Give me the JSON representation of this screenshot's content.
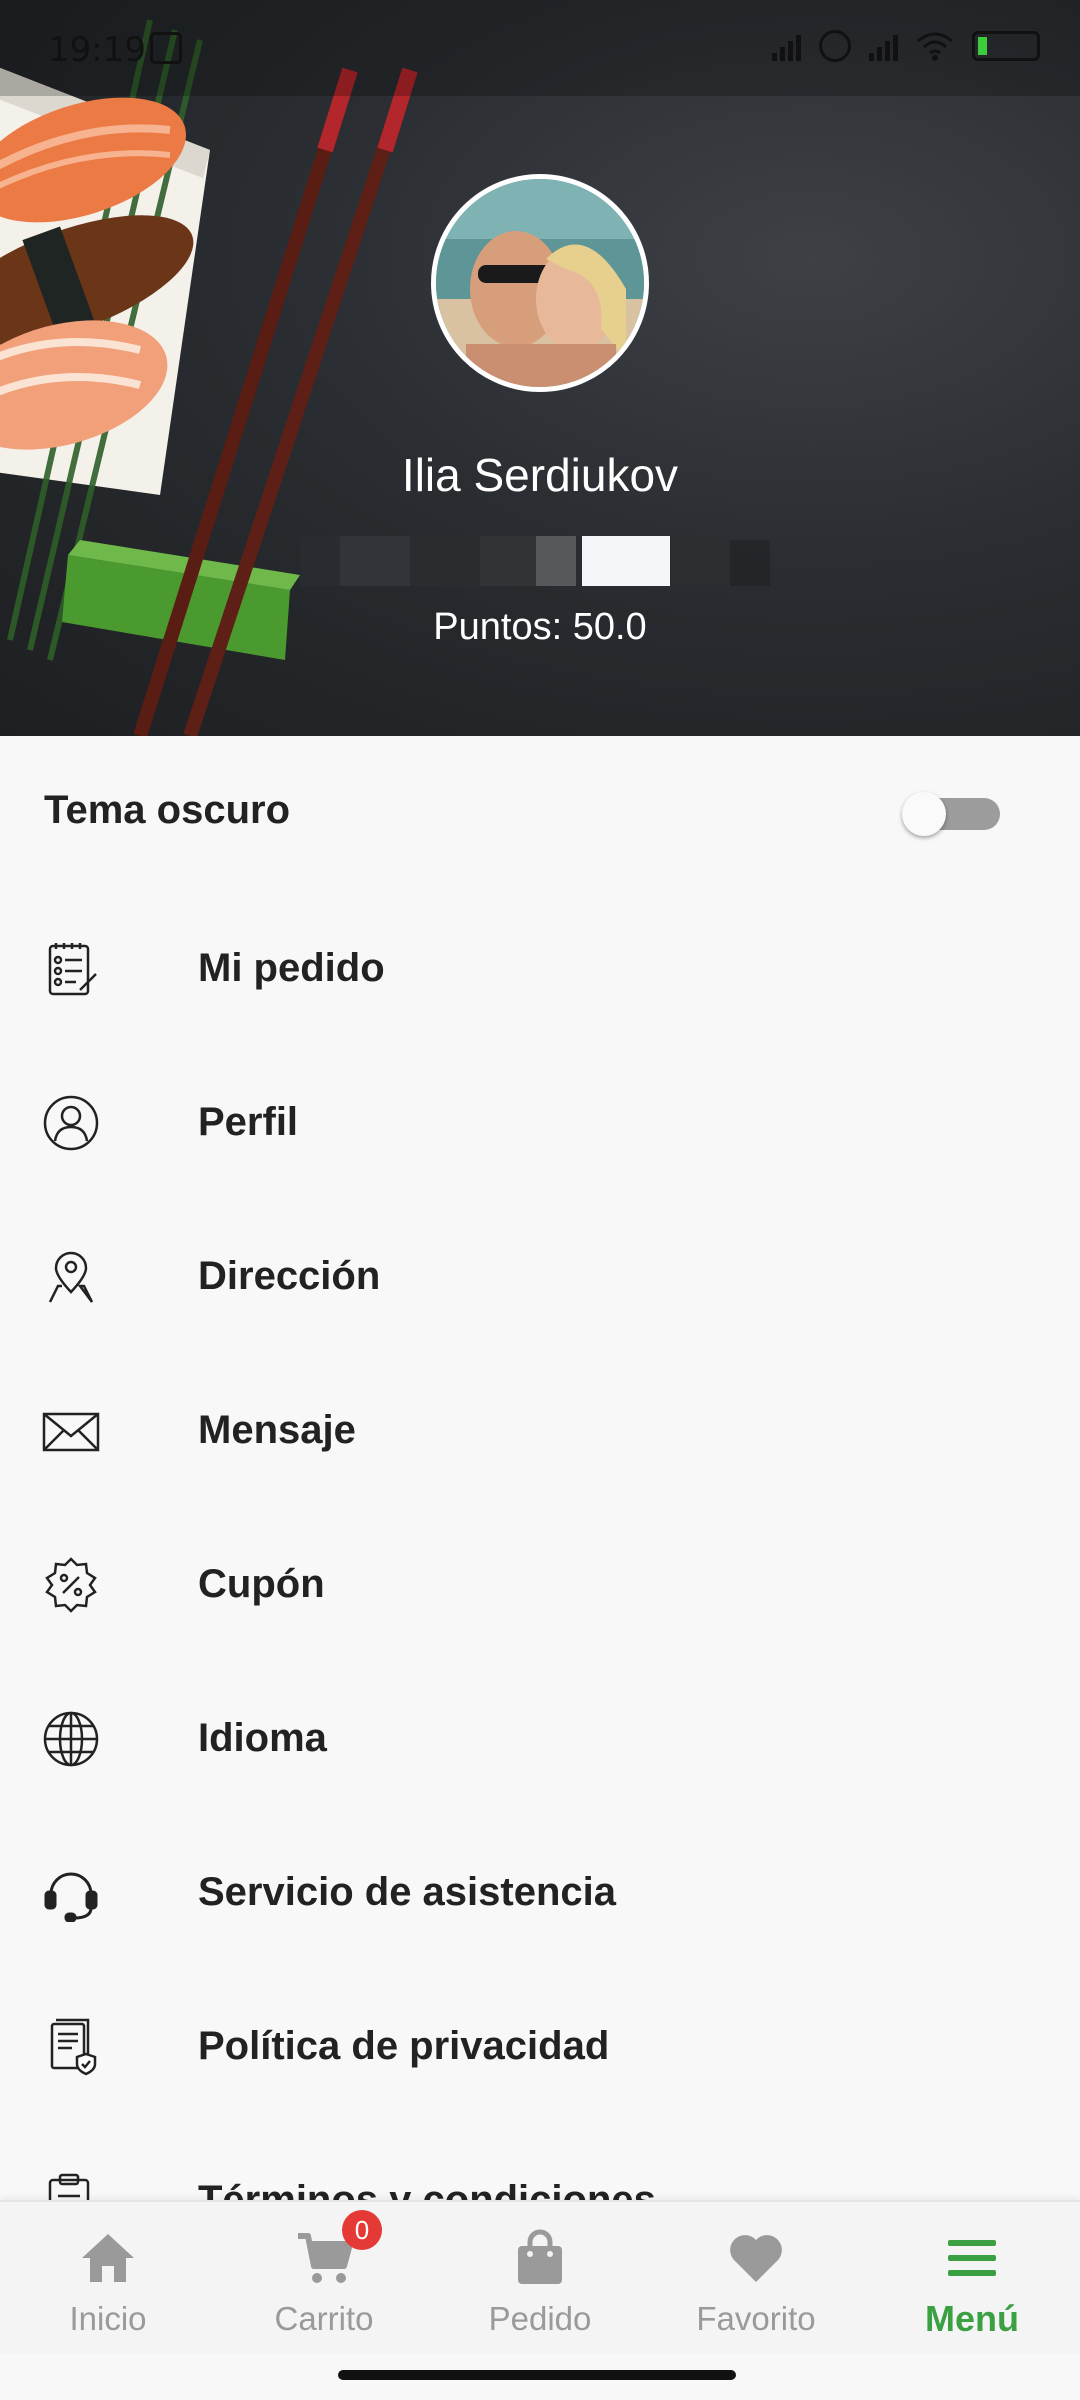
{
  "status_bar": {
    "time": "19:19"
  },
  "profile": {
    "name": "Ilia Serdiukov",
    "points": "Puntos: 50.0"
  },
  "settings": {
    "dark_theme_label": "Tema oscuro",
    "dark_theme_enabled": false
  },
  "menu": {
    "items": [
      {
        "label": "Mi pedido",
        "icon": "order-list-icon"
      },
      {
        "label": "Perfil",
        "icon": "user-icon"
      },
      {
        "label": "Dirección",
        "icon": "location-pin-icon"
      },
      {
        "label": "Mensaje",
        "icon": "envelope-icon"
      },
      {
        "label": "Cupón",
        "icon": "coupon-percent-icon"
      },
      {
        "label": "Idioma",
        "icon": "globe-icon"
      },
      {
        "label": "Servicio de asistencia",
        "icon": "headset-icon"
      },
      {
        "label": "Política de privacidad",
        "icon": "privacy-document-icon"
      },
      {
        "label": "Términos y condiciones",
        "icon": "clipboard-icon"
      }
    ]
  },
  "bottom_nav": {
    "items": [
      {
        "label": "Inicio",
        "icon": "home-icon",
        "active": false
      },
      {
        "label": "Carrito",
        "icon": "cart-icon",
        "active": false,
        "badge": "0"
      },
      {
        "label": "Pedido",
        "icon": "shopping-bag-icon",
        "active": false
      },
      {
        "label": "Favorito",
        "icon": "heart-icon",
        "active": false
      },
      {
        "label": "Menú",
        "icon": "hamburger-menu-icon",
        "active": true
      }
    ]
  },
  "colors": {
    "accent": "#3aa041",
    "badge": "#e53935",
    "inactive_nav": "#9a9a9a"
  }
}
